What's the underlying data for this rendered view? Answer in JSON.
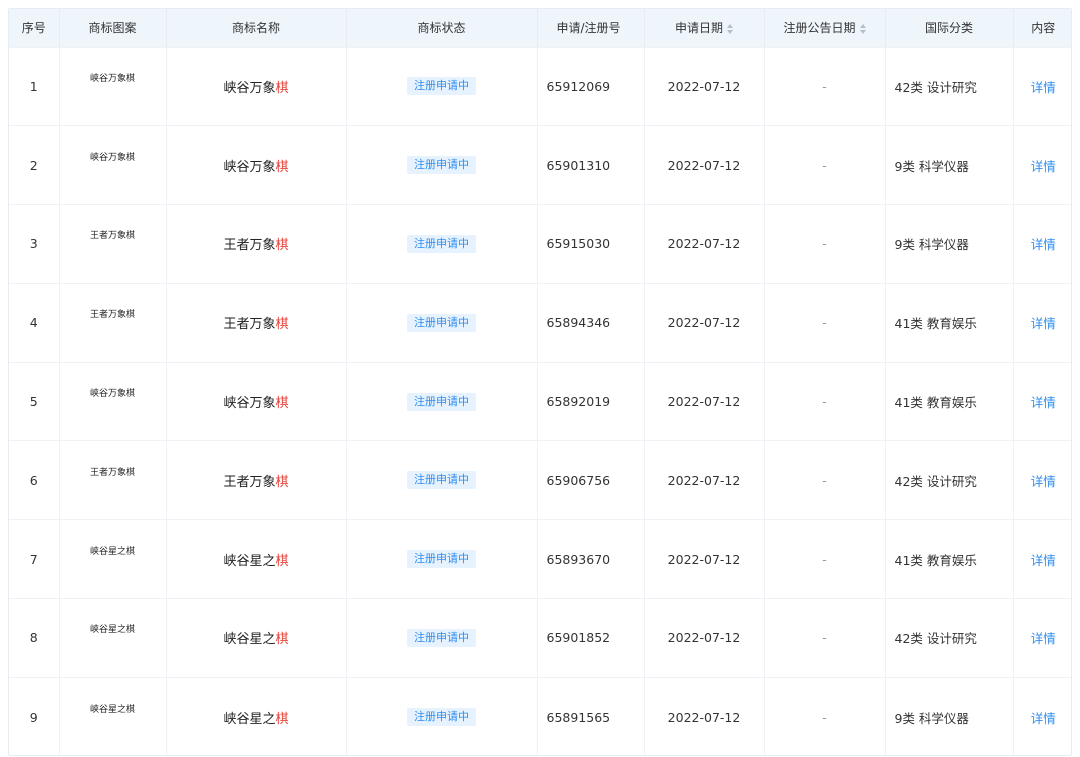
{
  "table": {
    "headers": {
      "index": "序号",
      "logo": "商标图案",
      "name": "商标名称",
      "status": "商标状态",
      "app_no": "申请/注册号",
      "app_date": "申请日期",
      "reg_date": "注册公告日期",
      "intl_class": "国际分类",
      "content": "内容"
    },
    "rows": [
      {
        "index": "1",
        "logo": "峡谷万象棋",
        "name_prefix": "峡谷万象",
        "name_highlight": "棋",
        "status": "注册申请中",
        "app_no": "65912069",
        "app_date": "2022-07-12",
        "reg_date": "-",
        "intl_class": "42类 设计研究",
        "detail": "详情"
      },
      {
        "index": "2",
        "logo": "峡谷万象棋",
        "name_prefix": "峡谷万象",
        "name_highlight": "棋",
        "status": "注册申请中",
        "app_no": "65901310",
        "app_date": "2022-07-12",
        "reg_date": "-",
        "intl_class": "9类 科学仪器",
        "detail": "详情"
      },
      {
        "index": "3",
        "logo": "王者万象棋",
        "name_prefix": "王者万象",
        "name_highlight": "棋",
        "status": "注册申请中",
        "app_no": "65915030",
        "app_date": "2022-07-12",
        "reg_date": "-",
        "intl_class": "9类 科学仪器",
        "detail": "详情"
      },
      {
        "index": "4",
        "logo": "王者万象棋",
        "name_prefix": "王者万象",
        "name_highlight": "棋",
        "status": "注册申请中",
        "app_no": "65894346",
        "app_date": "2022-07-12",
        "reg_date": "-",
        "intl_class": "41类 教育娱乐",
        "detail": "详情"
      },
      {
        "index": "5",
        "logo": "峡谷万象棋",
        "name_prefix": "峡谷万象",
        "name_highlight": "棋",
        "status": "注册申请中",
        "app_no": "65892019",
        "app_date": "2022-07-12",
        "reg_date": "-",
        "intl_class": "41类 教育娱乐",
        "detail": "详情"
      },
      {
        "index": "6",
        "logo": "王者万象棋",
        "name_prefix": "王者万象",
        "name_highlight": "棋",
        "status": "注册申请中",
        "app_no": "65906756",
        "app_date": "2022-07-12",
        "reg_date": "-",
        "intl_class": "42类 设计研究",
        "detail": "详情"
      },
      {
        "index": "7",
        "logo": "峡谷星之棋",
        "name_prefix": "峡谷星之",
        "name_highlight": "棋",
        "status": "注册申请中",
        "app_no": "65893670",
        "app_date": "2022-07-12",
        "reg_date": "-",
        "intl_class": "41类 教育娱乐",
        "detail": "详情"
      },
      {
        "index": "8",
        "logo": "峡谷星之棋",
        "name_prefix": "峡谷星之",
        "name_highlight": "棋",
        "status": "注册申请中",
        "app_no": "65901852",
        "app_date": "2022-07-12",
        "reg_date": "-",
        "intl_class": "42类 设计研究",
        "detail": "详情"
      },
      {
        "index": "9",
        "logo": "峡谷星之棋",
        "name_prefix": "峡谷星之",
        "name_highlight": "棋",
        "status": "注册申请中",
        "app_no": "65891565",
        "app_date": "2022-07-12",
        "reg_date": "-",
        "intl_class": "9类 科学仪器",
        "detail": "详情"
      }
    ]
  },
  "colors": {
    "header_bg": "#eef5fb",
    "status_text": "#2f8ef0",
    "status_bg": "#e6f2fd",
    "highlight": "#e8423b",
    "link": "#2f8ef0"
  }
}
